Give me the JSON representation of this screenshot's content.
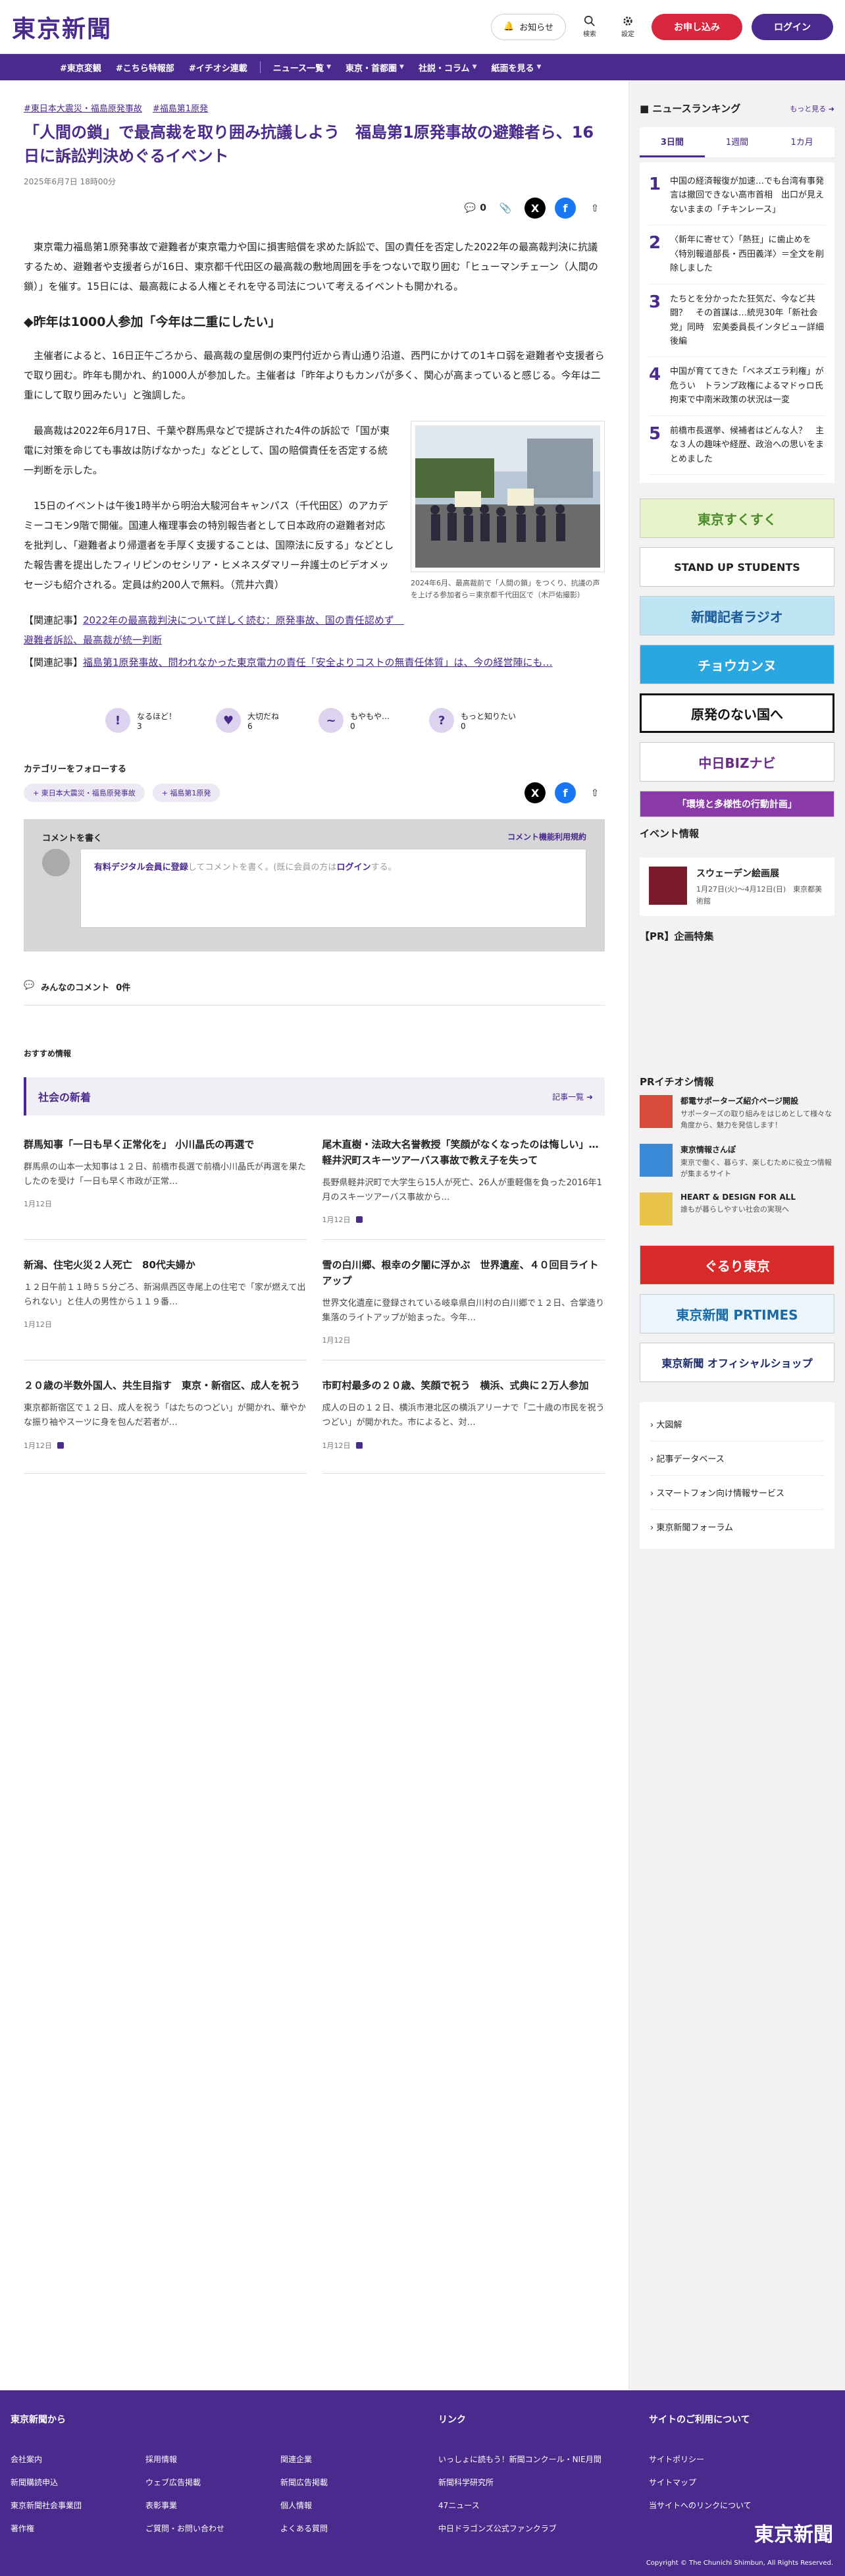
{
  "header": {
    "logo": "東京新聞",
    "notice": "お知らせ",
    "search": "検索",
    "settings": "設定",
    "apply": "お申し込み",
    "login": "ログイン"
  },
  "nav": {
    "hashtags": [
      "#東京変観",
      "#こちら特報部",
      "#イチオシ連載"
    ],
    "menus": [
      "ニュース一覧",
      "東京・首都圏",
      "社説・コラム",
      "紙面を見る"
    ]
  },
  "article": {
    "tags": [
      "#東日本大震災・福島原発事故",
      "#福島第1原発"
    ],
    "title": "「人間の鎖」で最高裁を取り囲み抗議しよう　福島第1原発事故の避難者ら、16日に訴訟判決めぐるイベント",
    "date": "2025年6月7日 18時00分",
    "comment_count": "0",
    "p1": "東京電力福島第1原発事故で避難者が東京電力や国に損害賠償を求めた訴訟で、国の責任を否定した2022年の最高裁判決に抗議するため、避難者や支援者らが16日、東京都千代田区の最高裁の敷地周囲を手をつないで取り囲む「ヒューマンチェーン（人間の鎖）」を催す。15日には、最高裁による人権とそれを守る司法について考えるイベントも開かれる。",
    "subheading": "◆昨年は1000人参加「今年は二重にしたい」",
    "p2": "主催者によると、16日正午ごろから、最高裁の皇居側の東門付近から青山通り沿道、西門にかけての1キロ弱を避難者や支援者らで取り囲む。昨年も開かれ、約1000人が参加した。主催者は「昨年よりもカンパが多く、関心が高まっていると感じる。今年は二重にして取り囲みたい」と強調した。",
    "p3": "最高裁は2022年6月17日、千葉や群馬県などで提訴された4件の訴訟で「国が東電に対策を命じても事故は防げなかった」などとして、国の賠償責任を否定する統一判断を示した。",
    "p4": "15日のイベントは午後1時半から明治大駿河台キャンパス（千代田区）のアカデミーコモン9階で開催。国連人権理事会の特別報告者として日本政府の避難者対応を批判し、「避難者より帰還者を手厚く支援することは、国際法に反する」などとした報告書を提出したフィリピンのセシリア・ヒメネスダマリー弁護士のビデオメッセージも紹介される。定員は約200人で無料。（荒井六貴）",
    "photo_caption": "2024年6月、最高裁前で「人間の鎖」をつくり、抗議の声を上げる参加者ら＝東京都千代田区で（木戸佑撮影）",
    "related1_label": "【関連記事】",
    "related1_link": "2022年の最高裁判決について詳しく読む：原発事故、国の責任認めず　避難者訴訟、最高裁が統一判断",
    "related2_label": "【関連記事】",
    "related2_link": "福島第1原発事故、問われなかった東京電力の責任「安全よりコストの無責任体質」は、今の経営陣にも…"
  },
  "reactions": [
    {
      "label": "なるほど！",
      "count": "3",
      "icon": "lightbulb-icon",
      "glyph": "!"
    },
    {
      "label": "大切だね",
      "count": "6",
      "icon": "heart-icon",
      "glyph": "♥"
    },
    {
      "label": "もやもや…",
      "count": "0",
      "icon": "cloud-icon",
      "glyph": "~"
    },
    {
      "label": "もっと知りたい",
      "count": "0",
      "icon": "question-icon",
      "glyph": "?"
    }
  ],
  "follow": {
    "label": "カテゴリーをフォローする",
    "chips": [
      "東日本大震災・福島原発事故",
      "福島第1原発"
    ]
  },
  "comment": {
    "write": "コメントを書く",
    "terms": "コメント機能利用規約",
    "register_link": "有料デジタル会員に登録",
    "text_mid": "してコメントを書く。(既に会員の方は",
    "login_link": "ログイン",
    "text_end": "する。",
    "all_label": "みんなのコメント",
    "all_count": "0件"
  },
  "recommend": {
    "label": "おすすめ情報",
    "section": "社会の新着",
    "more": "記事一覧",
    "items": [
      {
        "h": "群馬知事「一日も早く正常化を」 小川晶氏の再選で",
        "s": "群馬県の山本一太知事は１２日、前橋市長選で前橋小川晶氏が再選を果たしたのを受け「一日も早く市政が正常…",
        "d": "1月12日"
      },
      {
        "h": "尾木直樹・法政大名誉教授「笑顔がなくなったのは悔しい」…軽井沢町スキーツアーバス事故で教え子を失って",
        "s": "長野県軽井沢町で大学生ら15人が死亡、26人が重軽傷を負った2016年1月のスキーツアーバス事故から…",
        "d": "1月12日"
      },
      {
        "h": "新潟、住宅火災２人死亡　80代夫婦か",
        "s": "１２日午前１１時５５分ごろ、新潟県西区寺尾上の住宅で「家が燃えて出られない」と住人の男性から１１９番…",
        "d": "1月12日"
      },
      {
        "h": "雪の白川郷、根幸の夕闇に浮かぶ　世界遺産、４０回目ライトアップ",
        "s": "世界文化遺産に登録されている岐阜県白川村の白川郷で１２日、合掌造り集落のライトアップが始まった。今年…",
        "d": "1月12日"
      },
      {
        "h": "２０歳の半数外国人、共生目指す　東京・新宿区、成人を祝う",
        "s": "東京都新宿区で１２日、成人を祝う「はたちのつどい」が開かれ、華やかな振り袖やスーツに身を包んだ若者が…",
        "d": "1月12日"
      },
      {
        "h": "市町村最多の２０歳、笑顔で祝う　横浜、式典に２万人参加",
        "s": "成人の日の１２日、横浜市港北区の横浜アリーナで「二十歳の市民を祝うつどい」が開かれた。市によると、対…",
        "d": "1月12日"
      }
    ]
  },
  "sidebar": {
    "ranking_title": "ニュースランキング",
    "ranking_more": "もっと見る",
    "tabs": [
      "3日間",
      "1週間",
      "1カ月"
    ],
    "ranking": [
      {
        "n": "1",
        "t": "中国の経済報復が加速…でも台湾有事発言は撤回できない高市首相　出口が見えないままの「チキンレース」"
      },
      {
        "n": "2",
        "t": "〈新年に寄せて〉「熱狂」に歯止めを　〈特別報道部長・西田義洋〉＝全文を削除しました"
      },
      {
        "n": "3",
        "t": "たちとを分かったた狂気だ、今など共闘？　その首謀は…統児30年「新社会党」同時　宏美委員長インタビュー詳細後編"
      },
      {
        "n": "4",
        "t": "中国が育ててきた「ベネズエラ利権」が危うい　トランプ政権によるマドゥロ氏拘束で中南米政策の状況は一変"
      },
      {
        "n": "5",
        "t": "前橋市長選挙、候補者はどんな人？　主な３人の趣味や経歴、政治への思いをまとめました"
      }
    ],
    "banners": [
      "東京すくすく",
      "STAND UP STUDENTS",
      "新聞記者ラジオ",
      "チョウカンヌ",
      "原発のない国へ",
      "中日BIZナビ",
      "「環境と多様性の行動計画」"
    ],
    "event_title": "イベント情報",
    "event_h": "スウェーデン絵画展",
    "event_s": "1月27日(火)～4月12日(日)　東京都美術館",
    "pr_label": "【PR】企画特集",
    "pr_title": "PRイチオシ情報",
    "pr_items": [
      {
        "h": "都電サポーターズ紹介ページ開設",
        "s": "サポーターズの取り組みをはじめとして様々な角度から、魅力を発信します！"
      },
      {
        "h": "東京情報さんぽ",
        "s": "東京で働く、暮らす、楽しむために役立つ情報が集まるサイト"
      },
      {
        "h": "HEART & DESIGN FOR ALL",
        "s": "誰もが暮らしやすい社会の実現へ"
      }
    ],
    "banners2": [
      "ぐるり東京",
      "東京新聞 PRTIMES",
      "東京新聞 オフィシャルショップ"
    ],
    "links": [
      "大図解",
      "記事データベース",
      "スマートフォン向け情報サービス",
      "東京新聞フォーラム"
    ]
  },
  "footer": {
    "col1_title": "東京新聞から",
    "col1": [
      "会社案内",
      "採用情報",
      "関連企業",
      "新聞購読申込",
      "ウェブ広告掲載",
      "新聞広告掲載",
      "東京新聞社会事業団",
      "表彰事業",
      "個人情報",
      "著作権",
      "ご質問・お問い合わせ",
      "よくある質問"
    ],
    "col2_title": "リンク",
    "col2": [
      "いっしょに読もう！新聞コンクール・NIE月間",
      "新聞科学研究所",
      "47ニュース",
      "中日ドラゴンズ公式ファンクラブ"
    ],
    "col3_title": "サイトのご利用について",
    "col3": [
      "サイトポリシー",
      "サイトマップ",
      "当サイトへのリンクについて"
    ],
    "logo": "東京新聞",
    "copyright": "Copyright © The Chunichi Shimbun, All Rights Reserved."
  }
}
